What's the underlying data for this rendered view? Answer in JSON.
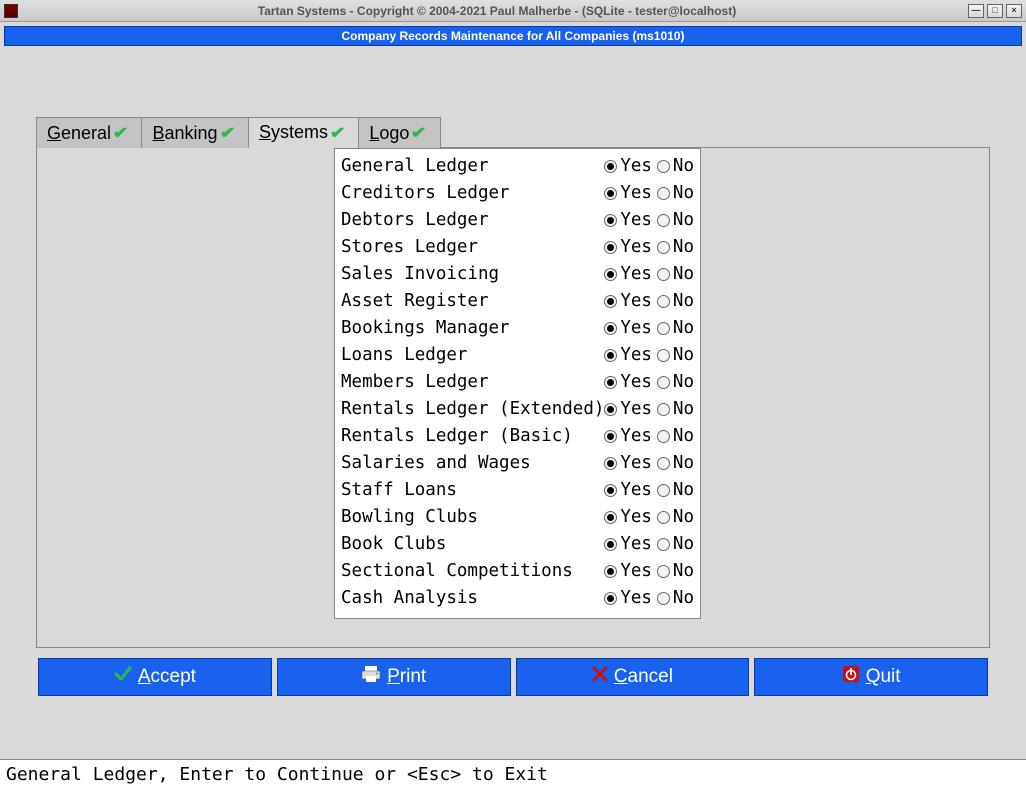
{
  "window": {
    "title": "Tartan Systems - Copyright © 2004-2021 Paul Malherbe - (SQLite - tester@localhost)"
  },
  "header": {
    "title": "Company Records Maintenance for All Companies (ms1010)"
  },
  "tabs": {
    "general": "eneral",
    "banking": "anking",
    "systems": "ystems",
    "logo": "ogo",
    "general_prefix": "G",
    "banking_prefix": "B",
    "systems_prefix": "S",
    "logo_prefix": "L"
  },
  "systems": [
    {
      "label": "General Ledger",
      "value": "Yes"
    },
    {
      "label": "Creditors Ledger",
      "value": "Yes"
    },
    {
      "label": "Debtors Ledger",
      "value": "Yes"
    },
    {
      "label": "Stores Ledger",
      "value": "Yes"
    },
    {
      "label": "Sales Invoicing",
      "value": "Yes"
    },
    {
      "label": "Asset Register",
      "value": "Yes"
    },
    {
      "label": "Bookings Manager",
      "value": "Yes"
    },
    {
      "label": "Loans Ledger",
      "value": "Yes"
    },
    {
      "label": "Members Ledger",
      "value": "Yes"
    },
    {
      "label": "Rentals Ledger (Extended)",
      "value": "Yes"
    },
    {
      "label": "Rentals Ledger (Basic)",
      "value": "Yes"
    },
    {
      "label": "Salaries and Wages",
      "value": "Yes"
    },
    {
      "label": "Staff Loans",
      "value": "Yes"
    },
    {
      "label": "Bowling Clubs",
      "value": "Yes"
    },
    {
      "label": "Book Clubs",
      "value": "Yes"
    },
    {
      "label": "Sectional Competitions",
      "value": "Yes"
    },
    {
      "label": "Cash Analysis",
      "value": "Yes"
    }
  ],
  "radio_labels": {
    "yes": "Yes",
    "no": "No"
  },
  "buttons": {
    "accept": "ccept",
    "accept_prefix": "A",
    "print": "rint",
    "print_prefix": "P",
    "cancel": "ancel",
    "cancel_prefix": "C",
    "quit": "uit",
    "quit_prefix": "Q"
  },
  "status": "General Ledger, Enter to Continue or <Esc> to Exit"
}
